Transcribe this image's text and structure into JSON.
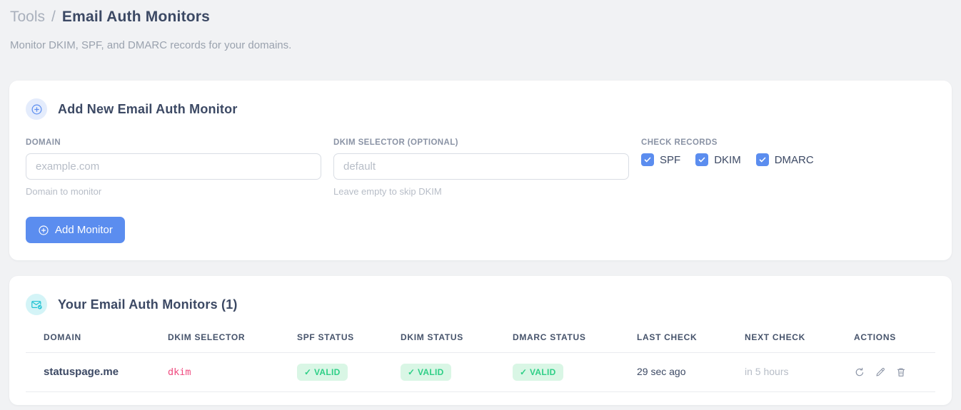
{
  "page": {
    "breadcrumb": {
      "section": "Tools",
      "separator": "/",
      "current": "Email Auth Monitors"
    },
    "subtitle": "Monitor DKIM, SPF, and DMARC records for your domains."
  },
  "add_monitor_card": {
    "title": "Add New Email Auth Monitor",
    "icon": "circle-plus-icon",
    "fields": {
      "domain": {
        "label": "DOMAIN",
        "value": "",
        "placeholder": "example.com",
        "hint": "Domain to monitor"
      },
      "dkim_selector": {
        "label": "DKIM SELECTOR (OPTIONAL)",
        "value": "",
        "placeholder": "default",
        "hint": "Leave empty to skip DKIM"
      }
    },
    "check_records": {
      "label": "CHECK RECORDS",
      "options": [
        {
          "label": "SPF",
          "checked": true
        },
        {
          "label": "DKIM",
          "checked": true
        },
        {
          "label": "DMARC",
          "checked": true
        }
      ]
    },
    "submit_label": "Add Monitor"
  },
  "monitors_card": {
    "title": "Your Email Auth Monitors (1)",
    "icon": "envelope-check-icon",
    "table": {
      "headers": [
        "DOMAIN",
        "DKIM SELECTOR",
        "SPF STATUS",
        "DKIM STATUS",
        "DMARC STATUS",
        "LAST CHECK",
        "NEXT CHECK",
        "ACTIONS"
      ],
      "rows": [
        {
          "domain": "statuspage.me",
          "dkim_selector": "dkim",
          "spf_status": "✓ VALID",
          "dkim_status": "✓ VALID",
          "dmarc_status": "✓ VALID",
          "last_check": "29 sec ago",
          "next_check": "in 5 hours",
          "actions": [
            "refresh-icon",
            "edit-icon",
            "delete-icon"
          ]
        }
      ]
    }
  },
  "colors": {
    "accent_blue": "#5b8def",
    "accent_blue_bg": "#e4ecfc",
    "teal": "#23c3d3",
    "teal_bg": "#d4f4f7",
    "success_text": "#2fcf87",
    "success_bg": "#d9f6e5",
    "code_pink": "#ef4a7f",
    "page_bg": "#f1f2f4"
  }
}
